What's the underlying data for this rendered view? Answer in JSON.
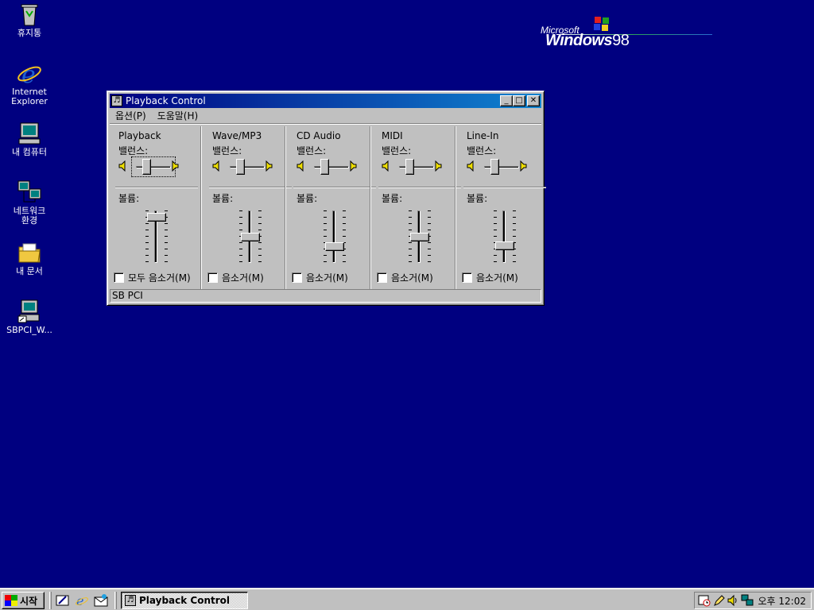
{
  "desktop": {
    "icons": [
      {
        "label": "휴지통",
        "icon": "recycle-bin-icon"
      },
      {
        "label": "Internet\nExplorer",
        "icon": "internet-explorer-icon"
      },
      {
        "label": "내 컴퓨터",
        "icon": "my-computer-icon"
      },
      {
        "label": "네트워크\n환경",
        "icon": "network-neighborhood-icon"
      },
      {
        "label": "내 문서",
        "icon": "my-documents-icon"
      },
      {
        "label": "SBPCI_W...",
        "icon": "sbpci-shortcut-icon"
      }
    ],
    "logo": {
      "microsoft": "Microsoft",
      "windows": "Windows",
      "version": "98"
    }
  },
  "window": {
    "title": "Playback Control",
    "menu": [
      "옵션(P)",
      "도움말(H)"
    ],
    "balance_label": "밸런스:",
    "volume_label": "볼륨:",
    "channels": [
      {
        "name": "Playback",
        "balance": 0.5,
        "volume": 0.95,
        "mute_label": "모두 음소거(M)",
        "muted": false
      },
      {
        "name": "Wave/MP3",
        "balance": 0.5,
        "volume": 0.5,
        "mute_label": "음소거(M)",
        "muted": false
      },
      {
        "name": "CD Audio",
        "balance": 0.5,
        "volume": 0.28,
        "mute_label": "음소거(M)",
        "muted": false
      },
      {
        "name": "MIDI",
        "balance": 0.5,
        "volume": 0.5,
        "mute_label": "음소거(M)",
        "muted": false
      },
      {
        "name": "Line-In",
        "balance": 0.5,
        "volume": 0.3,
        "mute_label": "음소거(M)",
        "muted": false
      }
    ],
    "status": "SB PCI"
  },
  "taskbar": {
    "start_label": "시작",
    "quick_launch": [
      "show-desktop-icon",
      "internet-explorer-icon",
      "outlook-express-icon"
    ],
    "task_button": "Playback Control",
    "tray_icons": [
      "scheduler-icon",
      "pen-icon",
      "volume-icon",
      "network-icon"
    ],
    "clock": "오후 12:02"
  }
}
